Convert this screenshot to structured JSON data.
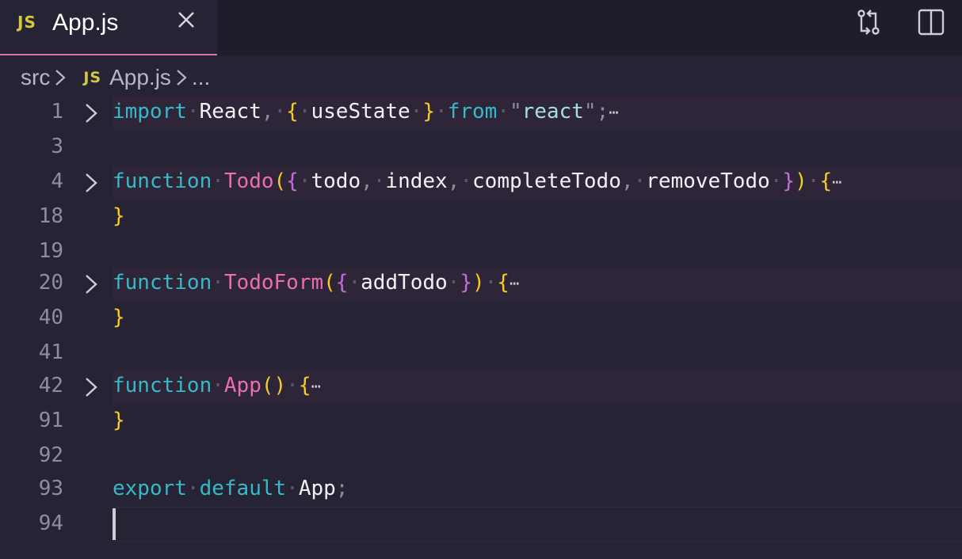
{
  "tab": {
    "icon": "JS",
    "label": "App.js",
    "close_icon": "close-icon"
  },
  "actions": [
    {
      "name": "compare-changes",
      "icon": "git-compare-icon"
    },
    {
      "name": "split-editor",
      "icon": "split-editor-icon"
    }
  ],
  "breadcrumb": {
    "folder": "src",
    "file_icon": "JS",
    "file": "App.js",
    "more": "..."
  },
  "lines": [
    {
      "number": "1",
      "folded": true
    },
    {
      "number": "3"
    },
    {
      "number": "4",
      "folded": true
    },
    {
      "number": "18"
    },
    {
      "number": "19"
    },
    {
      "number": "20",
      "folded": true
    },
    {
      "number": "40"
    },
    {
      "number": "41"
    },
    {
      "number": "42",
      "folded": true
    },
    {
      "number": "91"
    },
    {
      "number": "92"
    },
    {
      "number": "93"
    },
    {
      "number": "94",
      "current": true
    }
  ],
  "code": {
    "l1": {
      "import": "import",
      "react": "React",
      "comma": ",",
      "open": "{",
      "useState": "useState",
      "close": "}",
      "from": "from",
      "q1": "\"",
      "module": "react",
      "q2": "\"",
      "semi": ";"
    },
    "l4": {
      "function": "function",
      "name": "Todo",
      "paren": "(",
      "open": "{",
      "p1": "todo",
      "p2": "index",
      "p3": "completeTodo",
      "p4": "removeTodo",
      "close": "}",
      "paren_close": ")",
      "brace": "{"
    },
    "l18": {
      "brace": "}"
    },
    "l20": {
      "function": "function",
      "name": "TodoForm",
      "paren": "(",
      "open": "{",
      "p1": "addTodo",
      "close": "}",
      "paren_close": ")",
      "brace": "{"
    },
    "l40": {
      "brace": "}"
    },
    "l42": {
      "function": "function",
      "name": "App",
      "parens": "()",
      "brace": "{"
    },
    "l91": {
      "brace": "}"
    },
    "l93": {
      "export": "export",
      "default": "default",
      "app": "App",
      "semi": ";"
    }
  },
  "colors": {
    "background": "#262335",
    "keyword": "#36b9c9",
    "function_name": "#ec6cb4",
    "bracket_1": "#f7cc24",
    "bracket_2": "#c66ce0",
    "tab_accent": "#e06fbc"
  }
}
